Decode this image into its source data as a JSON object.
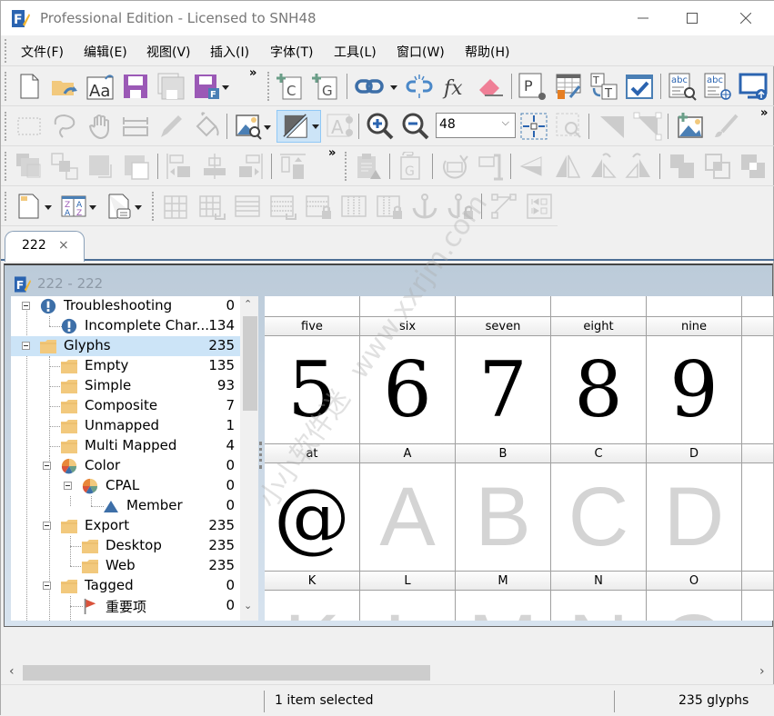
{
  "window": {
    "title": "Professional Edition - Licensed to SNH48",
    "minimize_label": "—",
    "maximize_label": "☐",
    "close_label": "✕"
  },
  "menu": [
    {
      "label": "文件(F)"
    },
    {
      "label": "编辑(E)"
    },
    {
      "label": "视图(V)"
    },
    {
      "label": "插入(I)"
    },
    {
      "label": "字体(T)"
    },
    {
      "label": "工具(L)"
    },
    {
      "label": "窗口(W)"
    },
    {
      "label": "帮助(H)"
    }
  ],
  "toolbar": {
    "overflow_label": "»",
    "zoom_value": "48",
    "zoom_arrow": "⌵"
  },
  "colors": {
    "accent_blue": "#4a7fb5",
    "purple_save": "#9b59b6",
    "folder": "#f2c97d",
    "selection": "#cce4f7",
    "flag_red": "#d9533c",
    "eraser_pink": "#ef7f96"
  },
  "document_tab": {
    "label": "222",
    "close_label": "×"
  },
  "document_window": {
    "title": "222 - 222"
  },
  "tree": {
    "items": [
      {
        "label": "Troubleshooting",
        "count": "0",
        "icon": "warning-icon"
      },
      {
        "label": "Incomplete Char...",
        "count": "134",
        "icon": "warning-icon"
      },
      {
        "label": "Glyphs",
        "count": "235",
        "icon": "folder-icon",
        "selected": true
      },
      {
        "label": "Empty",
        "count": "135",
        "icon": "folder-icon"
      },
      {
        "label": "Simple",
        "count": "93",
        "icon": "folder-icon"
      },
      {
        "label": "Composite",
        "count": "7",
        "icon": "folder-icon"
      },
      {
        "label": "Unmapped",
        "count": "1",
        "icon": "folder-icon"
      },
      {
        "label": "Multi Mapped",
        "count": "4",
        "icon": "folder-icon"
      },
      {
        "label": "Color",
        "count": "0",
        "icon": "color-wheel-icon"
      },
      {
        "label": "CPAL",
        "count": "0",
        "icon": "color-wheel-icon"
      },
      {
        "label": "Member",
        "count": "0",
        "icon": "triangle-icon"
      },
      {
        "label": "Export",
        "count": "235",
        "icon": "folder-icon"
      },
      {
        "label": "Desktop",
        "count": "235",
        "icon": "folder-icon"
      },
      {
        "label": "Web",
        "count": "235",
        "icon": "folder-icon"
      },
      {
        "label": "Tagged",
        "count": "0",
        "icon": "folder-icon"
      },
      {
        "label": "重要项",
        "count": "0",
        "icon": "flag-icon"
      }
    ],
    "scroll_up": "⌃",
    "scroll_down": "⌄"
  },
  "glyph_grid": {
    "rows": [
      {
        "cells": [
          {
            "name": "five",
            "char": "5",
            "style": "black"
          },
          {
            "name": "six",
            "char": "6",
            "style": "black"
          },
          {
            "name": "seven",
            "char": "7",
            "style": "black"
          },
          {
            "name": "eight",
            "char": "8",
            "style": "black"
          },
          {
            "name": "nine",
            "char": "9",
            "style": "black"
          }
        ]
      },
      {
        "cells": [
          {
            "name": "at",
            "char": "@",
            "style": "black"
          },
          {
            "name": "A",
            "char": "A",
            "style": "grey"
          },
          {
            "name": "B",
            "char": "B",
            "style": "grey"
          },
          {
            "name": "C",
            "char": "C",
            "style": "grey"
          },
          {
            "name": "D",
            "char": "D",
            "style": "grey"
          }
        ]
      },
      {
        "cells": [
          {
            "name": "K",
            "char": "K",
            "style": "grey"
          },
          {
            "name": "L",
            "char": "L",
            "style": "grey"
          },
          {
            "name": "M",
            "char": "M",
            "style": "grey"
          },
          {
            "name": "N",
            "char": "N",
            "style": "grey"
          },
          {
            "name": "O",
            "char": "O",
            "style": "grey"
          }
        ]
      }
    ]
  },
  "hscroll": {
    "left": "‹",
    "right": "›"
  },
  "status": {
    "selection": "1 item selected",
    "glyph_count": "235 glyphs"
  },
  "watermark": {
    "cn": "小小软件迷",
    "url": "www.xxrjm.com"
  }
}
